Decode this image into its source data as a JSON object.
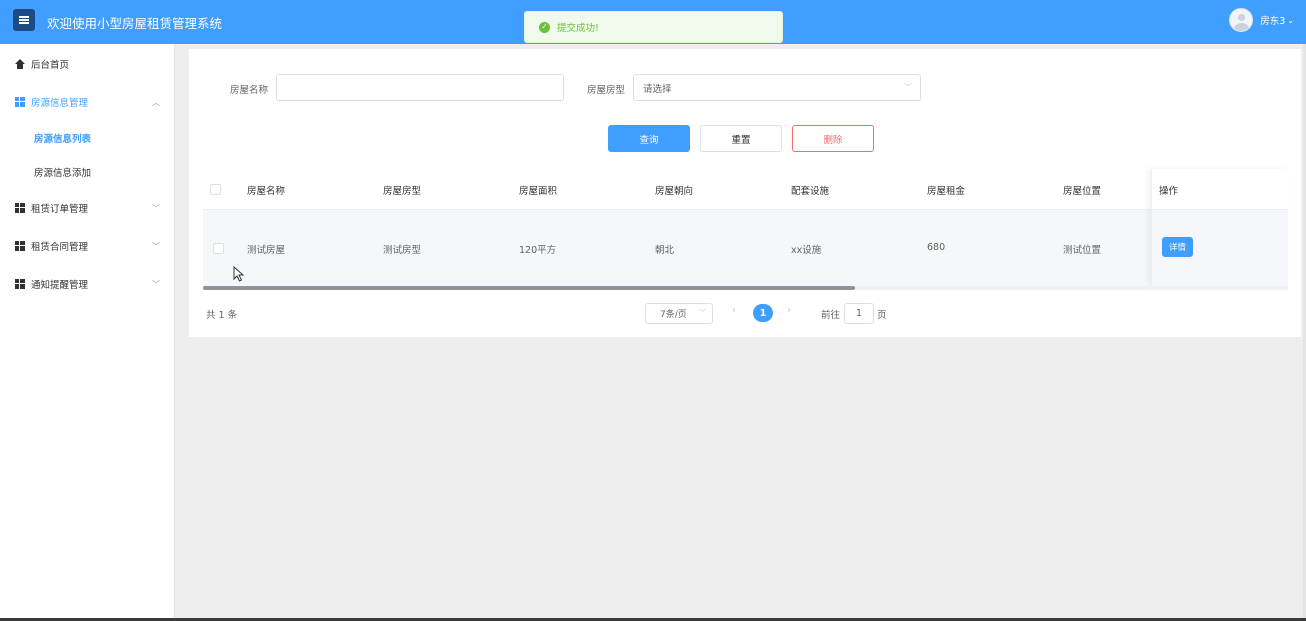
{
  "header": {
    "title": "欢迎使用小型房屋租赁管理系统",
    "username": "房东3",
    "menu_icon": "hamburger-icon",
    "accent": "#409eff"
  },
  "toast": {
    "message": "提交成功!",
    "color": "#67c23a"
  },
  "sidebar": {
    "items": [
      {
        "label": "后台首页",
        "icon": "home-icon"
      },
      {
        "label": "房源信息管理",
        "icon": "grid-icon",
        "expanded": true,
        "children": [
          {
            "label": "房源信息列表",
            "current": true
          },
          {
            "label": "房源信息添加"
          }
        ]
      },
      {
        "label": "租赁订单管理",
        "icon": "grid-icon"
      },
      {
        "label": "租赁合同管理",
        "icon": "grid-icon"
      },
      {
        "label": "通知提醒管理",
        "icon": "grid-icon"
      }
    ]
  },
  "filters": {
    "name_label": "房屋名称",
    "name_value": "",
    "type_label": "房屋房型",
    "type_placeholder": "请选择"
  },
  "actions": {
    "query": "查询",
    "reset": "重置",
    "delete": "删除"
  },
  "table": {
    "columns": [
      "房屋名称",
      "房屋房型",
      "房屋面积",
      "房屋朝向",
      "配套设施",
      "房屋租金",
      "房屋位置",
      "操作"
    ],
    "rows": [
      [
        "测试房屋",
        "测试房型",
        "120平方",
        "朝北",
        "xx设施",
        "680",
        "测试位置"
      ]
    ],
    "row_action": "详情"
  },
  "pagination": {
    "total": "共 1 条",
    "page_size": "7条/页",
    "current_page": "1",
    "goto_prefix": "前往",
    "goto_value": "1",
    "goto_suffix": "页"
  }
}
